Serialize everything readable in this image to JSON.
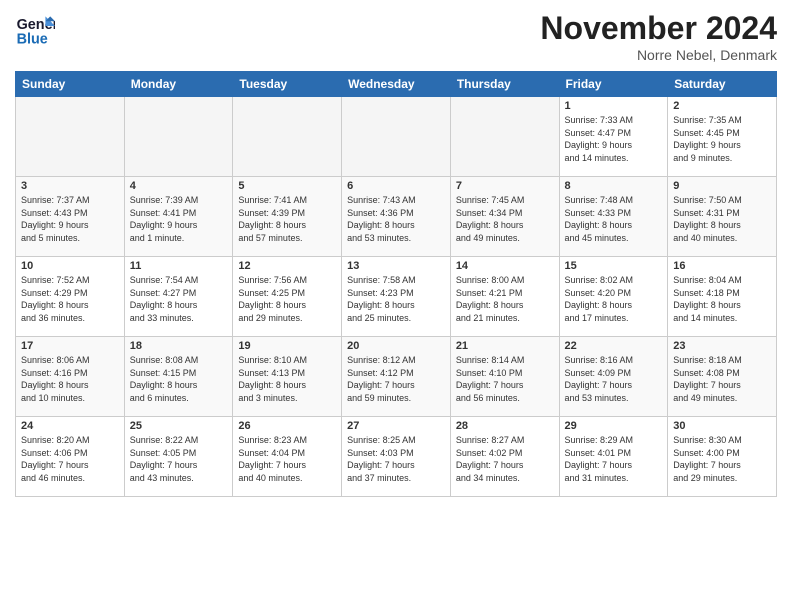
{
  "logo": {
    "general": "General",
    "blue": "Blue"
  },
  "title": "November 2024",
  "location": "Norre Nebel, Denmark",
  "days_of_week": [
    "Sunday",
    "Monday",
    "Tuesday",
    "Wednesday",
    "Thursday",
    "Friday",
    "Saturday"
  ],
  "weeks": [
    [
      {
        "day": "",
        "info": ""
      },
      {
        "day": "",
        "info": ""
      },
      {
        "day": "",
        "info": ""
      },
      {
        "day": "",
        "info": ""
      },
      {
        "day": "",
        "info": ""
      },
      {
        "day": "1",
        "info": "Sunrise: 7:33 AM\nSunset: 4:47 PM\nDaylight: 9 hours\nand 14 minutes."
      },
      {
        "day": "2",
        "info": "Sunrise: 7:35 AM\nSunset: 4:45 PM\nDaylight: 9 hours\nand 9 minutes."
      }
    ],
    [
      {
        "day": "3",
        "info": "Sunrise: 7:37 AM\nSunset: 4:43 PM\nDaylight: 9 hours\nand 5 minutes."
      },
      {
        "day": "4",
        "info": "Sunrise: 7:39 AM\nSunset: 4:41 PM\nDaylight: 9 hours\nand 1 minute."
      },
      {
        "day": "5",
        "info": "Sunrise: 7:41 AM\nSunset: 4:39 PM\nDaylight: 8 hours\nand 57 minutes."
      },
      {
        "day": "6",
        "info": "Sunrise: 7:43 AM\nSunset: 4:36 PM\nDaylight: 8 hours\nand 53 minutes."
      },
      {
        "day": "7",
        "info": "Sunrise: 7:45 AM\nSunset: 4:34 PM\nDaylight: 8 hours\nand 49 minutes."
      },
      {
        "day": "8",
        "info": "Sunrise: 7:48 AM\nSunset: 4:33 PM\nDaylight: 8 hours\nand 45 minutes."
      },
      {
        "day": "9",
        "info": "Sunrise: 7:50 AM\nSunset: 4:31 PM\nDaylight: 8 hours\nand 40 minutes."
      }
    ],
    [
      {
        "day": "10",
        "info": "Sunrise: 7:52 AM\nSunset: 4:29 PM\nDaylight: 8 hours\nand 36 minutes."
      },
      {
        "day": "11",
        "info": "Sunrise: 7:54 AM\nSunset: 4:27 PM\nDaylight: 8 hours\nand 33 minutes."
      },
      {
        "day": "12",
        "info": "Sunrise: 7:56 AM\nSunset: 4:25 PM\nDaylight: 8 hours\nand 29 minutes."
      },
      {
        "day": "13",
        "info": "Sunrise: 7:58 AM\nSunset: 4:23 PM\nDaylight: 8 hours\nand 25 minutes."
      },
      {
        "day": "14",
        "info": "Sunrise: 8:00 AM\nSunset: 4:21 PM\nDaylight: 8 hours\nand 21 minutes."
      },
      {
        "day": "15",
        "info": "Sunrise: 8:02 AM\nSunset: 4:20 PM\nDaylight: 8 hours\nand 17 minutes."
      },
      {
        "day": "16",
        "info": "Sunrise: 8:04 AM\nSunset: 4:18 PM\nDaylight: 8 hours\nand 14 minutes."
      }
    ],
    [
      {
        "day": "17",
        "info": "Sunrise: 8:06 AM\nSunset: 4:16 PM\nDaylight: 8 hours\nand 10 minutes."
      },
      {
        "day": "18",
        "info": "Sunrise: 8:08 AM\nSunset: 4:15 PM\nDaylight: 8 hours\nand 6 minutes."
      },
      {
        "day": "19",
        "info": "Sunrise: 8:10 AM\nSunset: 4:13 PM\nDaylight: 8 hours\nand 3 minutes."
      },
      {
        "day": "20",
        "info": "Sunrise: 8:12 AM\nSunset: 4:12 PM\nDaylight: 7 hours\nand 59 minutes."
      },
      {
        "day": "21",
        "info": "Sunrise: 8:14 AM\nSunset: 4:10 PM\nDaylight: 7 hours\nand 56 minutes."
      },
      {
        "day": "22",
        "info": "Sunrise: 8:16 AM\nSunset: 4:09 PM\nDaylight: 7 hours\nand 53 minutes."
      },
      {
        "day": "23",
        "info": "Sunrise: 8:18 AM\nSunset: 4:08 PM\nDaylight: 7 hours\nand 49 minutes."
      }
    ],
    [
      {
        "day": "24",
        "info": "Sunrise: 8:20 AM\nSunset: 4:06 PM\nDaylight: 7 hours\nand 46 minutes."
      },
      {
        "day": "25",
        "info": "Sunrise: 8:22 AM\nSunset: 4:05 PM\nDaylight: 7 hours\nand 43 minutes."
      },
      {
        "day": "26",
        "info": "Sunrise: 8:23 AM\nSunset: 4:04 PM\nDaylight: 7 hours\nand 40 minutes."
      },
      {
        "day": "27",
        "info": "Sunrise: 8:25 AM\nSunset: 4:03 PM\nDaylight: 7 hours\nand 37 minutes."
      },
      {
        "day": "28",
        "info": "Sunrise: 8:27 AM\nSunset: 4:02 PM\nDaylight: 7 hours\nand 34 minutes."
      },
      {
        "day": "29",
        "info": "Sunrise: 8:29 AM\nSunset: 4:01 PM\nDaylight: 7 hours\nand 31 minutes."
      },
      {
        "day": "30",
        "info": "Sunrise: 8:30 AM\nSunset: 4:00 PM\nDaylight: 7 hours\nand 29 minutes."
      }
    ]
  ]
}
